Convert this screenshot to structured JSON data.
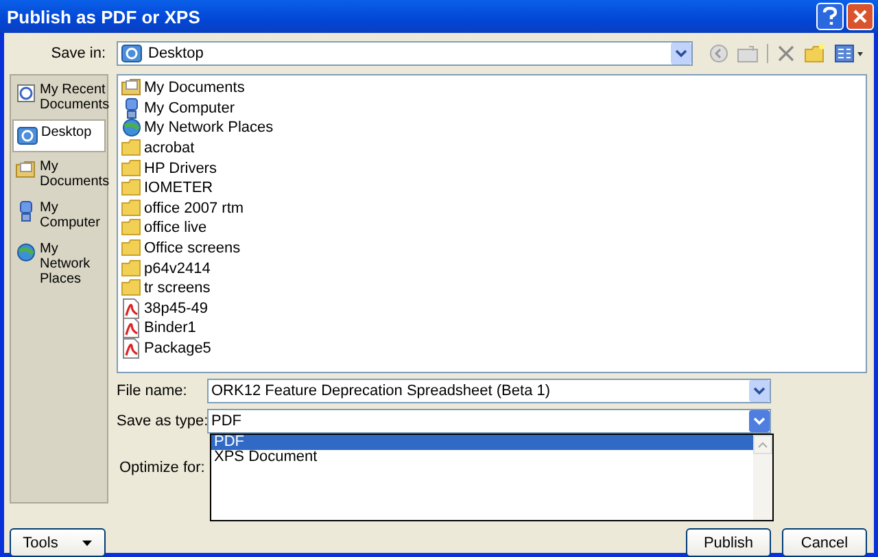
{
  "window": {
    "title": "Publish as PDF or XPS"
  },
  "save_in": {
    "label": "Save in:",
    "value": "Desktop"
  },
  "places": [
    {
      "label": "My Recent Documents",
      "kind": "recent",
      "selected": false
    },
    {
      "label": "Desktop",
      "kind": "desktop",
      "selected": true
    },
    {
      "label": "My Documents",
      "kind": "documents",
      "selected": false
    },
    {
      "label": "My Computer",
      "kind": "computer",
      "selected": false
    },
    {
      "label": "My Network Places",
      "kind": "network",
      "selected": false
    }
  ],
  "files": [
    {
      "name": "My Documents",
      "kind": "documents"
    },
    {
      "name": "My Computer",
      "kind": "computer"
    },
    {
      "name": "My Network Places",
      "kind": "network"
    },
    {
      "name": "acrobat",
      "kind": "folder"
    },
    {
      "name": "HP Drivers",
      "kind": "folder"
    },
    {
      "name": "IOMETER",
      "kind": "folder"
    },
    {
      "name": "office 2007 rtm",
      "kind": "folder"
    },
    {
      "name": "office live",
      "kind": "folder"
    },
    {
      "name": "Office screens",
      "kind": "folder"
    },
    {
      "name": "p64v2414",
      "kind": "folder"
    },
    {
      "name": "tr screens",
      "kind": "folder"
    },
    {
      "name": "38p45-49",
      "kind": "pdf"
    },
    {
      "name": "Binder1",
      "kind": "pdf"
    },
    {
      "name": "Package5",
      "kind": "pdf"
    }
  ],
  "file_name": {
    "label": "File name:",
    "value": "ORK12 Feature Deprecation Spreadsheet (Beta 1)"
  },
  "save_as_type": {
    "label": "Save as type:",
    "value": "PDF",
    "options": [
      {
        "label": "PDF",
        "selected": true
      },
      {
        "label": "XPS Document",
        "selected": false
      }
    ]
  },
  "optimize_for": {
    "label": "Optimize for:"
  },
  "buttons": {
    "tools": "Tools",
    "publish": "Publish",
    "cancel": "Cancel"
  }
}
